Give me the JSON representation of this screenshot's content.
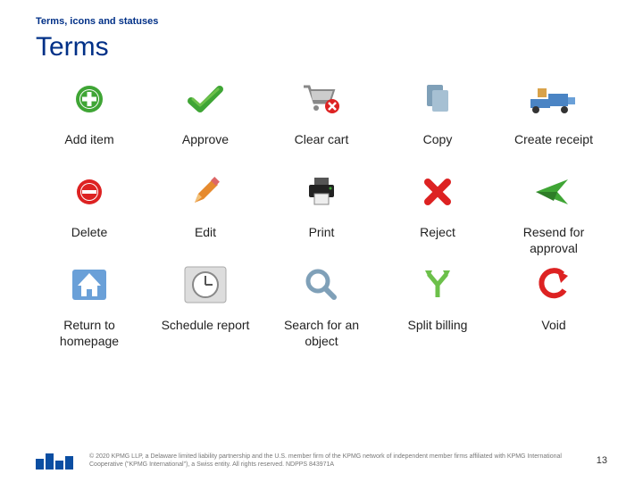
{
  "breadcrumb": "Terms, icons and statuses",
  "title": "Terms",
  "items": [
    {
      "label": "Add item"
    },
    {
      "label": "Approve"
    },
    {
      "label": "Clear cart"
    },
    {
      "label": "Copy"
    },
    {
      "label": "Create receipt"
    },
    {
      "label": "Delete"
    },
    {
      "label": "Edit"
    },
    {
      "label": "Print"
    },
    {
      "label": "Reject"
    },
    {
      "label": "Resend for approval"
    },
    {
      "label": "Return to homepage"
    },
    {
      "label": "Schedule report"
    },
    {
      "label": "Search for an object"
    },
    {
      "label": "Split billing"
    },
    {
      "label": "Void"
    }
  ],
  "footer": {
    "copyright": "© 2020 KPMG LLP, a Delaware limited liability partnership and the U.S. member firm of the KPMG network of independent member firms affiliated with KPMG International Cooperative (\"KPMG International\"), a Swiss entity. All rights reserved. NDPPS 843971A",
    "page_number": "13"
  }
}
